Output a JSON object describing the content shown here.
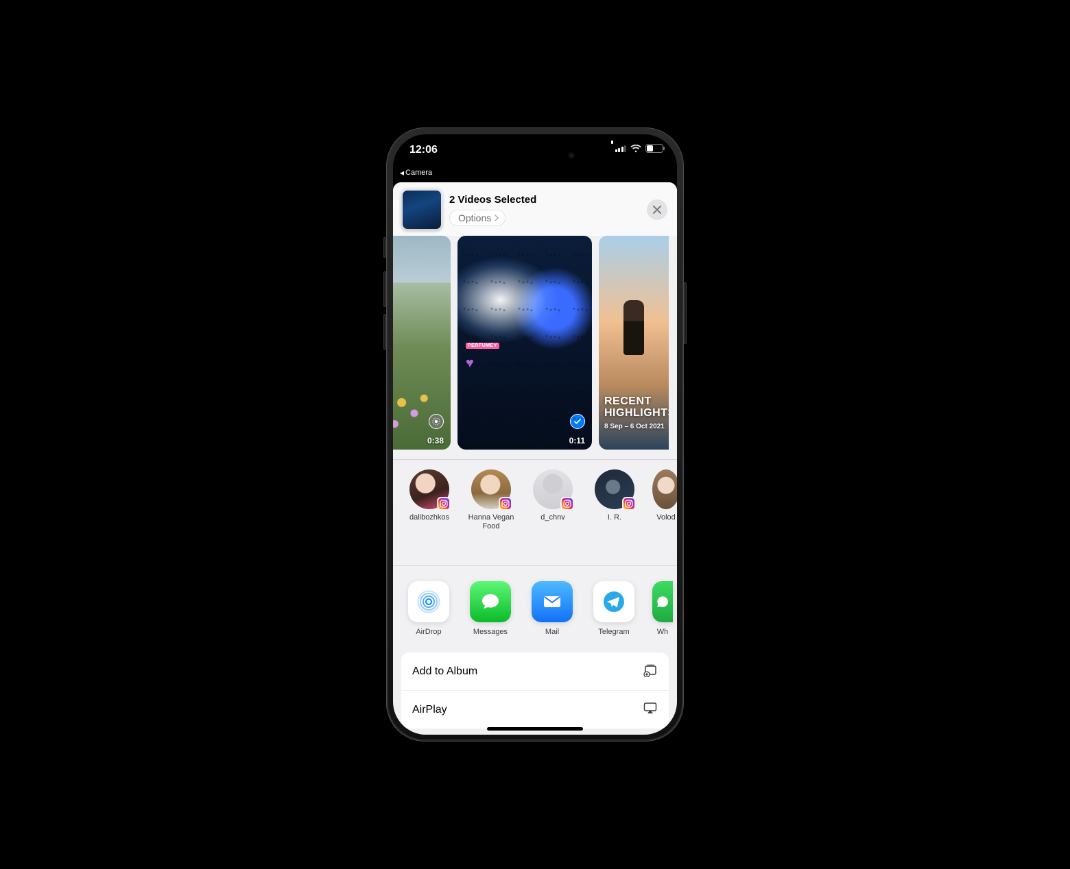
{
  "status": {
    "time": "12:06",
    "back_app_label": "Camera",
    "battery_percent": "36"
  },
  "sheet": {
    "title": "2 Videos Selected",
    "options_label": "Options",
    "media": [
      {
        "duration": "0:38",
        "selected": false,
        "live": true
      },
      {
        "duration": "0:11",
        "selected": true,
        "sticker_label": "PERFUMEY"
      },
      {
        "overlay_title": "RECENT HIGHLIGHTS",
        "overlay_sub": "8 Sep – 6 Oct 2021"
      }
    ],
    "contacts": [
      {
        "name": "dalibozhkos"
      },
      {
        "name": "Hanna Vegan Food"
      },
      {
        "name": "d_chnv"
      },
      {
        "name": "I. R."
      },
      {
        "name": "Volod"
      }
    ],
    "apps": [
      {
        "name": "AirDrop"
      },
      {
        "name": "Messages"
      },
      {
        "name": "Mail"
      },
      {
        "name": "Telegram"
      },
      {
        "name": "Wh"
      }
    ],
    "actions": [
      {
        "label": "Add to Album"
      },
      {
        "label": "AirPlay"
      }
    ]
  }
}
